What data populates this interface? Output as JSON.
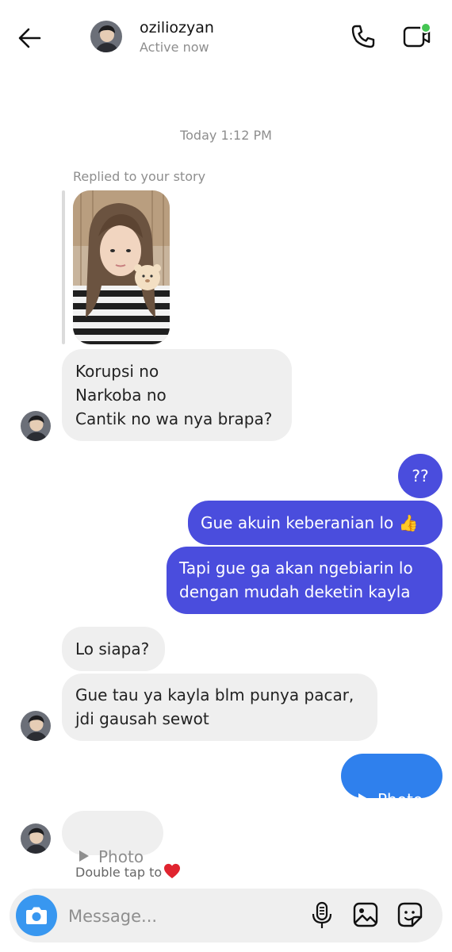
{
  "header": {
    "username": "oziliozyan",
    "status": "Active now",
    "back_icon": "arrow-left-icon",
    "call_icon": "phone-icon",
    "video_icon": "video-call-icon",
    "online_color": "#44c553"
  },
  "thread": {
    "timestamp": "Today 1:12 PM",
    "story_reply_label": "Replied to your story",
    "messages": [
      {
        "from": "them",
        "text": "Korupsi no\nNarkoba no\nCantik no wa nya brapa?"
      },
      {
        "from": "me",
        "text": "??"
      },
      {
        "from": "me",
        "text": "Gue akuin keberanian lo 👍"
      },
      {
        "from": "me",
        "text": "Tapi gue ga akan ngebiarin lo\ndengan mudah deketin kayla"
      },
      {
        "from": "them",
        "text": "Lo siapa?"
      },
      {
        "from": "them",
        "text": "Gue tau ya kayla blm punya pacar,\njdi gausah sewot"
      },
      {
        "from": "me",
        "text": "Photo"
      },
      {
        "from": "them",
        "text": "Photo"
      }
    ],
    "double_tap_hint": "Double tap to"
  },
  "composer": {
    "placeholder": "Message...",
    "camera_icon": "camera-icon",
    "mic_icon": "microphone-icon",
    "gallery_icon": "gallery-icon",
    "sticker_icon": "sticker-icon"
  },
  "colors": {
    "outgoing_bubble": "#4a4ddd",
    "photo_bubble": "#2f80ed",
    "incoming_bubble": "#efefef",
    "camera_button": "#3897f0"
  }
}
